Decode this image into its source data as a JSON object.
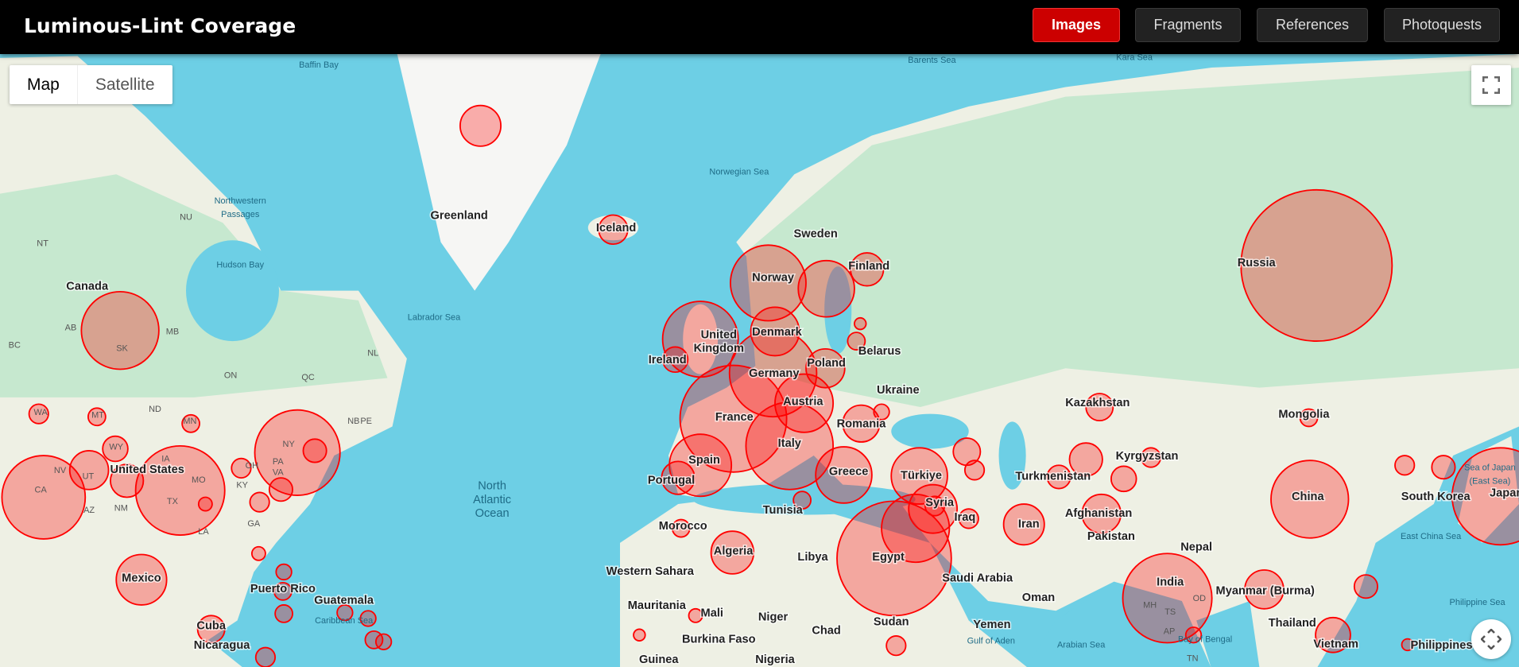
{
  "header": {
    "title": "Luminous-Lint Coverage",
    "nav": [
      {
        "label": "Images",
        "active": true
      },
      {
        "label": "Fragments"
      },
      {
        "label": "References"
      },
      {
        "label": "Photoquests"
      }
    ]
  },
  "map": {
    "map_types": [
      "Map",
      "Satellite"
    ],
    "selected_type": "Map",
    "colors": {
      "water": "#6dcfe5",
      "land": "#eef0e4",
      "green": "#c6e8cf",
      "marker": "#ff0000"
    },
    "labels": {
      "countries": [
        "Greenland",
        "Iceland",
        "Canada",
        "Sweden",
        "Norway",
        "Finland",
        "United Kingdom",
        "Denmark",
        "Ireland",
        "Belarus",
        "Germany",
        "Poland",
        "Ukraine",
        "France",
        "Austria",
        "Romania",
        "Italy",
        "Spain",
        "Portugal",
        "Greece",
        "Türkiye",
        "Syria",
        "Iraq",
        "Iran",
        "Tunisia",
        "Morocco",
        "Algeria",
        "Libya",
        "Egypt",
        "Saudi Arabia",
        "Russia",
        "Kazakhstan",
        "Mongolia",
        "Kyrgyzstan",
        "Turkmenistan",
        "Afghanistan",
        "Pakistan",
        "Nepal",
        "India",
        "China",
        "South Korea",
        "Japan",
        "Myanmar (Burma)",
        "Thailand",
        "Vietnam",
        "Philippines",
        "United States",
        "Mexico",
        "Cuba",
        "Puerto Rico",
        "Guatemala",
        "Nicaragua",
        "Western Sahara",
        "Mauritania",
        "Mali",
        "Niger",
        "Chad",
        "Sudan",
        "Burkina Faso",
        "Nigeria",
        "Guinea",
        "Yemen",
        "Oman"
      ],
      "regions": [
        "NT",
        "NU",
        "AB",
        "SK",
        "MB",
        "BC",
        "ON",
        "QC",
        "NL",
        "NB",
        "PE",
        "WA",
        "MT",
        "ND",
        "MN",
        "WY",
        "NV",
        "UT",
        "CA",
        "NM",
        "TX",
        "MO",
        "KY",
        "VA",
        "NY",
        "PA",
        "OH",
        "GA",
        "LA",
        "AZ",
        "IA",
        "MH",
        "TS",
        "OD",
        "AP",
        "TN"
      ],
      "water": [
        "Baffin Bay",
        "Barents Sea",
        "Kara Sea",
        "Norwegian Sea",
        "Northwestern Passages",
        "Hudson Bay",
        "Labrador Sea",
        "North Atlantic Ocean",
        "Caribbean Sea",
        "Arabian Sea",
        "Bay of Bengal",
        "East China Sea",
        "Philippine Sea",
        "Sea of Japan (East Sea)",
        "Gulf of Aden"
      ]
    }
  }
}
